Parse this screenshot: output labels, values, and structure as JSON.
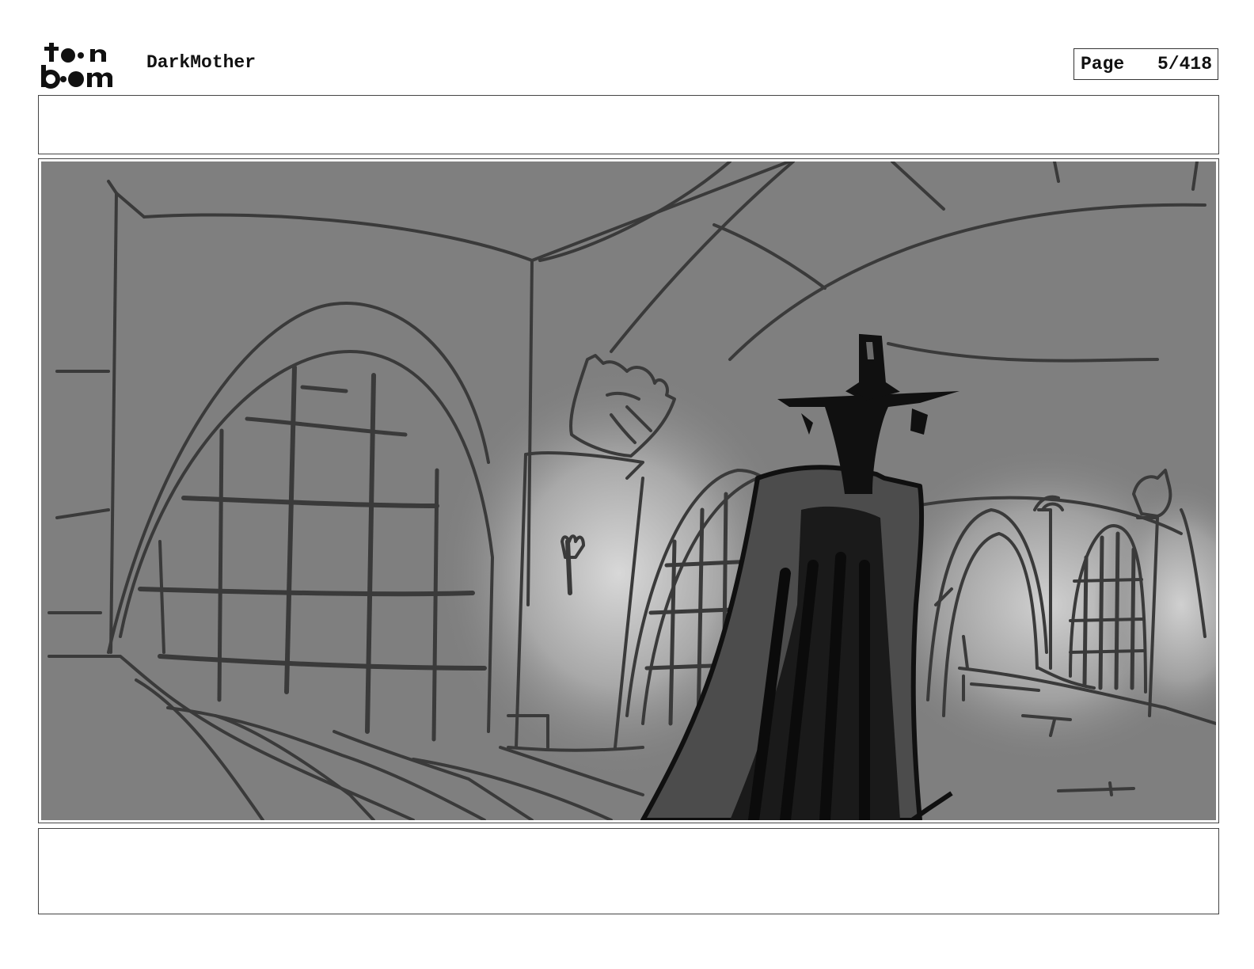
{
  "header": {
    "logo_text": "toon boom",
    "project_title": "DarkMother",
    "page_label": "Page",
    "page_number": "5/418"
  },
  "panel": {
    "image_icon": "storyboard-sketch-castle-hall-icon"
  },
  "colors": {
    "panel_gray": "#7f7f7f",
    "line": "#3a3a3a",
    "figure": "#101010"
  }
}
